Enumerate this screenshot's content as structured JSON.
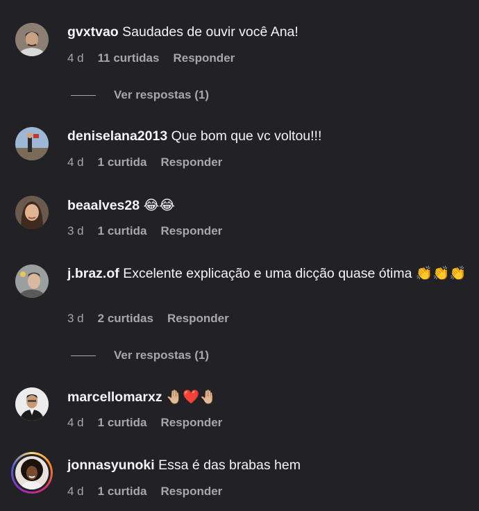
{
  "comments": [
    {
      "username": "gvxtvao",
      "text": "Saudades de ouvir você Ana!",
      "age": "4 d",
      "likes": "11 curtidas",
      "reply": "Responder",
      "view_replies": "Ver respostas (1)",
      "avatar_colors": {
        "bg": "#8a7f72",
        "skin": "#c9a184",
        "hair": "#3b2a20"
      }
    },
    {
      "username": "deniselana2013",
      "text": "Que bom que vc voltou!!!",
      "age": "4 d",
      "likes": "1 curtida",
      "reply": "Responder",
      "avatar_colors": {
        "bg": "#9db7d6",
        "skin": "#d8a27a",
        "hair": "#222"
      }
    },
    {
      "username": "beaalves28",
      "text": "😂😂",
      "age": "3 d",
      "likes": "1 curtida",
      "reply": "Responder",
      "avatar_colors": {
        "bg": "#6a5a4e",
        "skin": "#e0b493",
        "hair": "#3e2a1e"
      }
    },
    {
      "username": "j.braz.of",
      "text": "Excelente explicação e uma dicção quase ótima 👏👏👏",
      "age": "3 d",
      "likes": "2 curtidas",
      "reply": "Responder",
      "view_replies": "Ver respostas (1)",
      "avatar_colors": {
        "bg": "#9aa0a0",
        "skin": "#d8b89e",
        "hair": "#4a3a2e"
      }
    },
    {
      "username": "marcellomarxz",
      "text": "🤚🏼❤️🤚🏼",
      "age": "4 d",
      "likes": "1 curtida",
      "reply": "Responder",
      "avatar_colors": {
        "bg": "#ececec",
        "skin": "#c79a78",
        "hair": "#1d1d1d"
      }
    },
    {
      "username": "jonnasyunoki",
      "text": "Essa é das brabas hem",
      "age": "4 d",
      "likes": "1 curtida",
      "reply": "Responder",
      "avatar_colors": {
        "bg": "#e7e3dc",
        "skin": "#7a4a2e",
        "hair": "#1b120d"
      }
    }
  ]
}
